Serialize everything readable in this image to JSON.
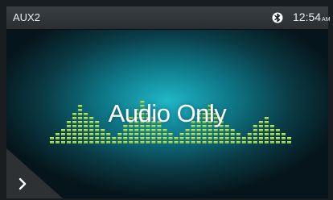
{
  "status_bar": {
    "source": "AUX2",
    "bluetooth_icon": "bluetooth-icon",
    "time": "12:54",
    "time_suffix": "AM"
  },
  "main": {
    "title": "Audio Only",
    "next_icon": "chevron-right-icon"
  },
  "equalizer": {
    "colors": {
      "top": "#d6e86a",
      "bottom": "#5ab13a"
    },
    "bar_segments": [
      2,
      3,
      4,
      6,
      8,
      10,
      8,
      7,
      6,
      4,
      3,
      2,
      3,
      5,
      7,
      9,
      11,
      9,
      7,
      6,
      4,
      3,
      2,
      3,
      4,
      6,
      8,
      9,
      10,
      8,
      7,
      5,
      4,
      3,
      2,
      3,
      5,
      6,
      7,
      5,
      4,
      3,
      2
    ]
  }
}
